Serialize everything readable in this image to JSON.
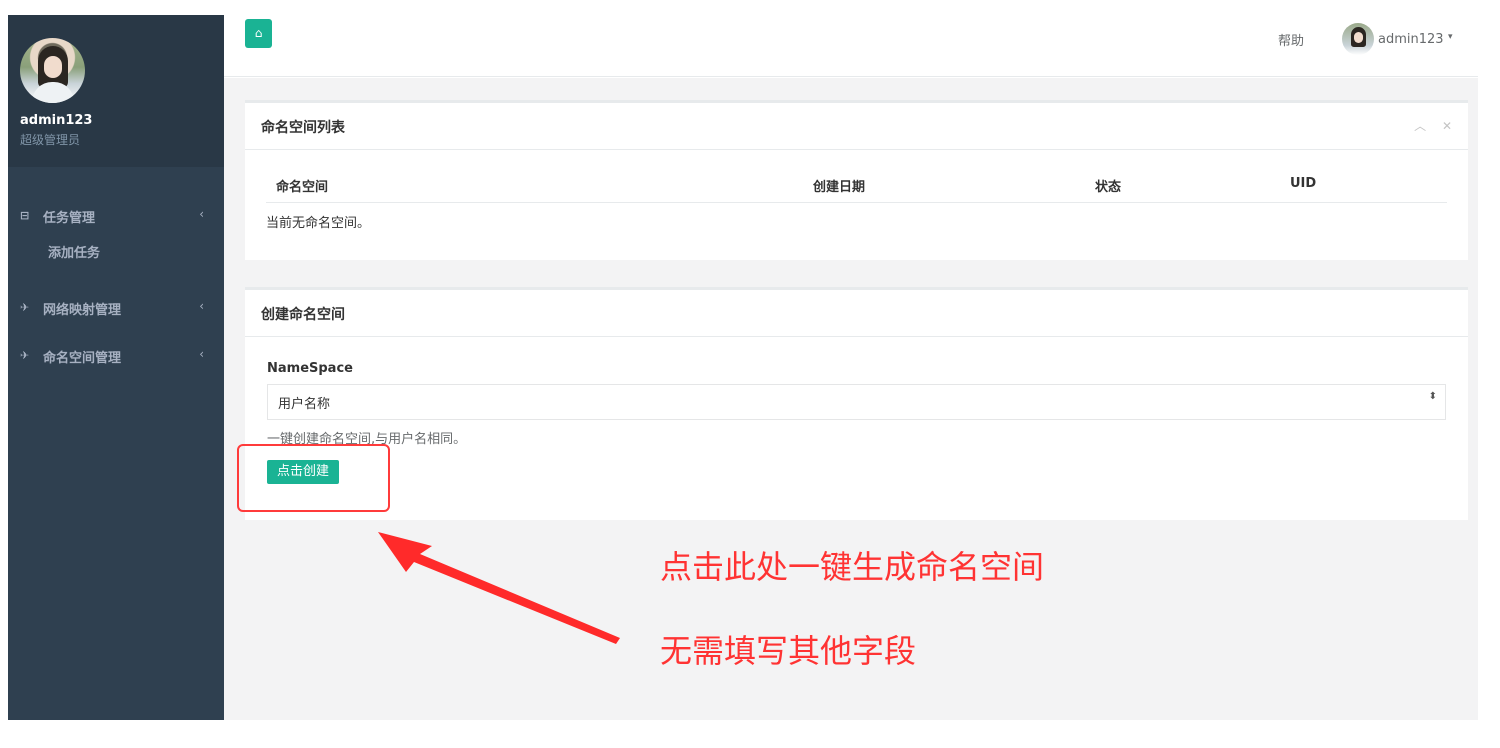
{
  "sidebar": {
    "user_name": "admin123",
    "user_role": "超级管理员",
    "items": [
      {
        "icon": "monitor-icon",
        "glyph": "⊟",
        "label": "任务管理",
        "arrow": "‹"
      },
      {
        "icon": "plane-icon",
        "glyph": "✈",
        "label": "网络映射管理",
        "arrow": "‹"
      },
      {
        "icon": "plane-icon",
        "glyph": "✈",
        "label": "命名空间管理",
        "arrow": "‹"
      }
    ],
    "sub_items": [
      {
        "label": "添加任务"
      }
    ]
  },
  "topbar": {
    "home_glyph": "⌂",
    "help_label": "帮助",
    "user_name": "admin123",
    "caret": "▾"
  },
  "namespace_list": {
    "title": "命名空间列表",
    "tools": {
      "collapse": "︿",
      "close": "✕"
    },
    "columns": [
      "命名空间",
      "创建日期",
      "状态",
      "UID"
    ],
    "empty_text": "当前无命名空间。"
  },
  "create_namespace": {
    "title": "创建命名空间",
    "field_label": "NameSpace",
    "select_value": "用户名称",
    "select_arrows": "⬍",
    "help_text": "一键创建命名空间,与用户名相同。",
    "button_label": "点击创建"
  },
  "annotation": {
    "line1": "点击此处一键生成命名空间",
    "line2": "无需填写其他字段"
  },
  "colors": {
    "sidebar": "#2f4050",
    "accent": "#1ab394",
    "annotation": "#ff3333"
  }
}
